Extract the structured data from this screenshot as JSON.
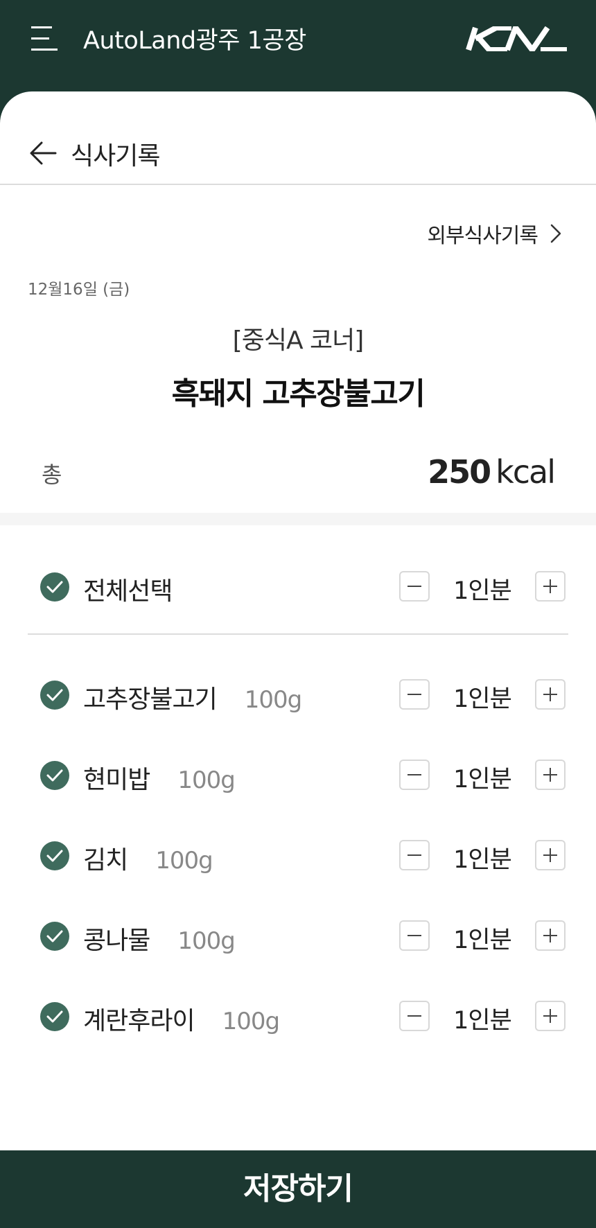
{
  "header": {
    "title": "AutoLand광주 1공장",
    "brand_logo": "KIA"
  },
  "nav": {
    "page_title": "식사기록"
  },
  "external_link": "외부식사기록",
  "date": "12월16일 (금)",
  "corner": "[중식A 코너]",
  "menu_name": "흑돼지 고추장불고기",
  "total": {
    "label": "총",
    "value": "250",
    "unit": "kcal"
  },
  "select_all": {
    "label": "전체선택",
    "quantity": "1인분",
    "checked": true
  },
  "items": [
    {
      "name": "고추장불고기",
      "weight": "100g",
      "quantity": "1인분",
      "checked": true
    },
    {
      "name": "현미밥",
      "weight": "100g",
      "quantity": "1인분",
      "checked": true
    },
    {
      "name": "김치",
      "weight": "100g",
      "quantity": "1인분",
      "checked": true
    },
    {
      "name": "콩나물",
      "weight": "100g",
      "quantity": "1인분",
      "checked": true
    },
    {
      "name": "계란후라이",
      "weight": "100g",
      "quantity": "1인분",
      "checked": true
    }
  ],
  "save_button": "저장하기",
  "icons": {
    "menu": "menu-icon",
    "back": "arrow-left-icon",
    "chevron": "chevron-right-icon",
    "check": "check-circle-icon",
    "minus": "minus-icon",
    "plus": "plus-icon"
  },
  "colors": {
    "primary": "#1c3831",
    "check": "#3f6b5d"
  }
}
